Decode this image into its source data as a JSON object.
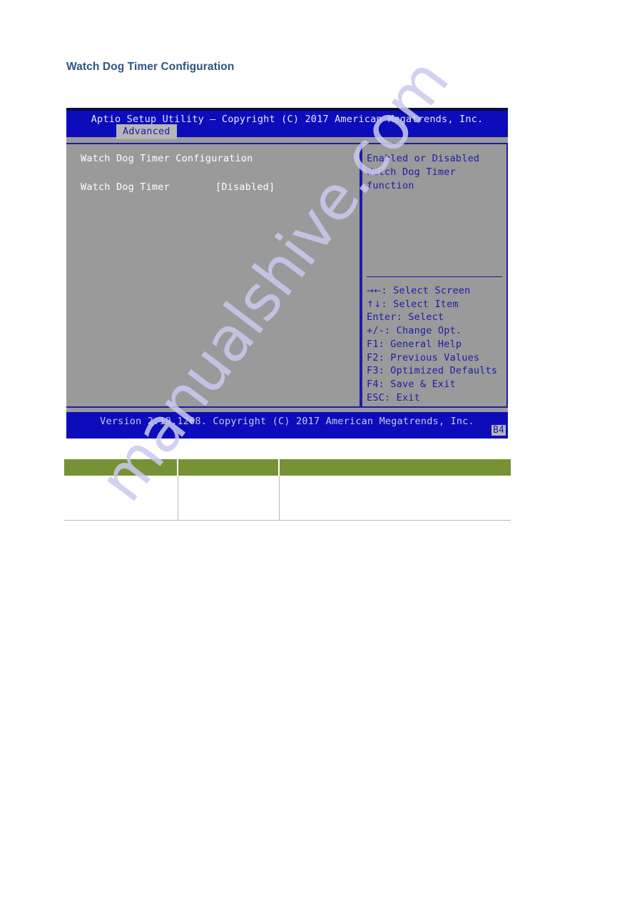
{
  "document": {
    "heading": "Watch Dog Timer Configuration"
  },
  "watermark": {
    "text": "manualshive.com",
    "color": "#c9caef"
  },
  "bios": {
    "title": "Aptio Setup Utility – Copyright (C) 2017 American Megatrends, Inc.",
    "active_tab": "Advanced",
    "tabs": [
      "Advanced"
    ],
    "section_title": "Watch Dog Timer Configuration",
    "settings": [
      {
        "label": "Watch Dog Timer",
        "value": "[Disabled]"
      }
    ],
    "help": {
      "line1": "Enabled or Disabled",
      "line2": "Watch Dog Timer function"
    },
    "keys": [
      {
        "glyph": "→←",
        "label": ": Select Screen"
      },
      {
        "glyph": "↑↓",
        "label": ": Select Item"
      },
      {
        "glyph": "",
        "label": "Enter: Select"
      },
      {
        "glyph": "",
        "label": "+/-: Change Opt."
      },
      {
        "glyph": "",
        "label": "F1: General Help"
      },
      {
        "glyph": "",
        "label": "F2: Previous Values"
      },
      {
        "glyph": "",
        "label": "F3: Optimized Defaults"
      },
      {
        "glyph": "",
        "label": "F4: Save & Exit"
      },
      {
        "glyph": "",
        "label": "ESC: Exit"
      }
    ],
    "footer": "Version 2.19.1268. Copyright (C) 2017 American Megatrends, Inc.",
    "page_badge": "B4",
    "colors": {
      "chrome_blue": "#0c0cbb",
      "panel_gray": "#9a9a9a",
      "border_blue": "#1c1ca8",
      "text_white": "#ffffff"
    }
  },
  "table": {
    "header_color": "#769234",
    "headers": [
      "",
      "",
      ""
    ],
    "rows": [
      [
        "",
        "",
        ""
      ]
    ]
  }
}
